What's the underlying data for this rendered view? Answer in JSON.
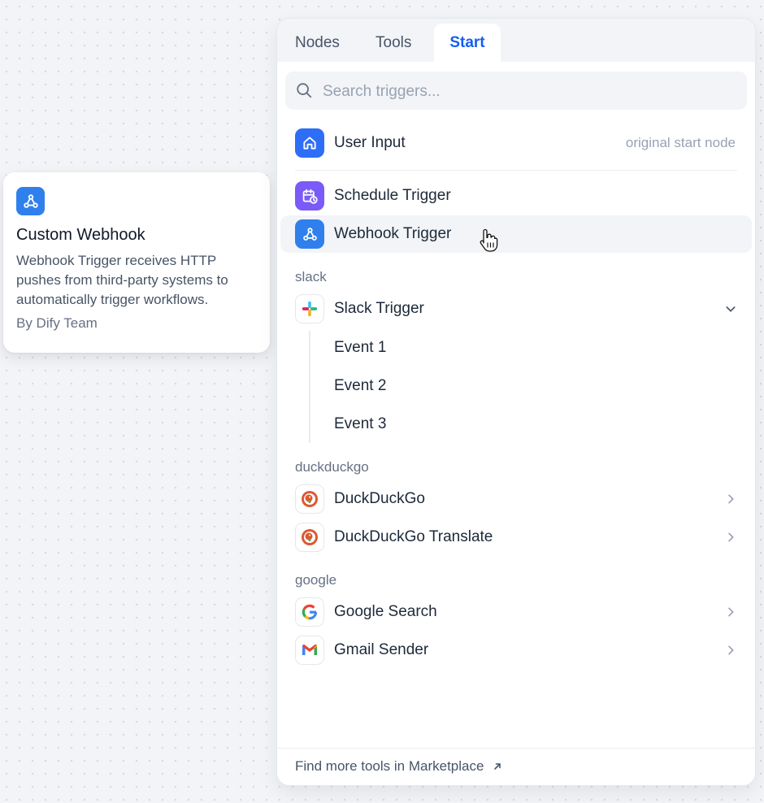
{
  "card": {
    "title": "Custom Webhook",
    "description": "Webhook Trigger receives HTTP pushes from third-party systems to automatically trigger workflows.",
    "author": "By Dify Team",
    "icon": "webhook-icon",
    "icon_color": "#2f80ed"
  },
  "tabs": [
    {
      "label": "Nodes"
    },
    {
      "label": "Tools"
    },
    {
      "label": "Start",
      "active": true
    }
  ],
  "search": {
    "placeholder": "Search triggers..."
  },
  "items": {
    "user_input": {
      "label": "User Input",
      "hint": "original start node",
      "icon": "home-icon",
      "color": "#2e6ef7"
    },
    "schedule": {
      "label": "Schedule Trigger",
      "icon": "calendar-clock-icon",
      "color": "#7a5af8"
    },
    "webhook": {
      "label": "Webhook Trigger",
      "icon": "webhook-icon",
      "color": "#2f80ed"
    }
  },
  "groups": {
    "slack": {
      "label": "slack",
      "trigger": {
        "label": "Slack Trigger",
        "icon": "slack-icon"
      },
      "events": [
        "Event 1",
        "Event 2",
        "Event 3"
      ]
    },
    "duckduckgo": {
      "label": "duckduckgo",
      "items": [
        "DuckDuckGo",
        "DuckDuckGo Translate"
      ]
    },
    "google": {
      "label": "google",
      "items": [
        "Google Search",
        "Gmail Sender"
      ]
    }
  },
  "footer": {
    "label": "Find more tools in Marketplace",
    "icon": "external-arrow-icon"
  },
  "colors": {
    "accent": "#155eef"
  }
}
